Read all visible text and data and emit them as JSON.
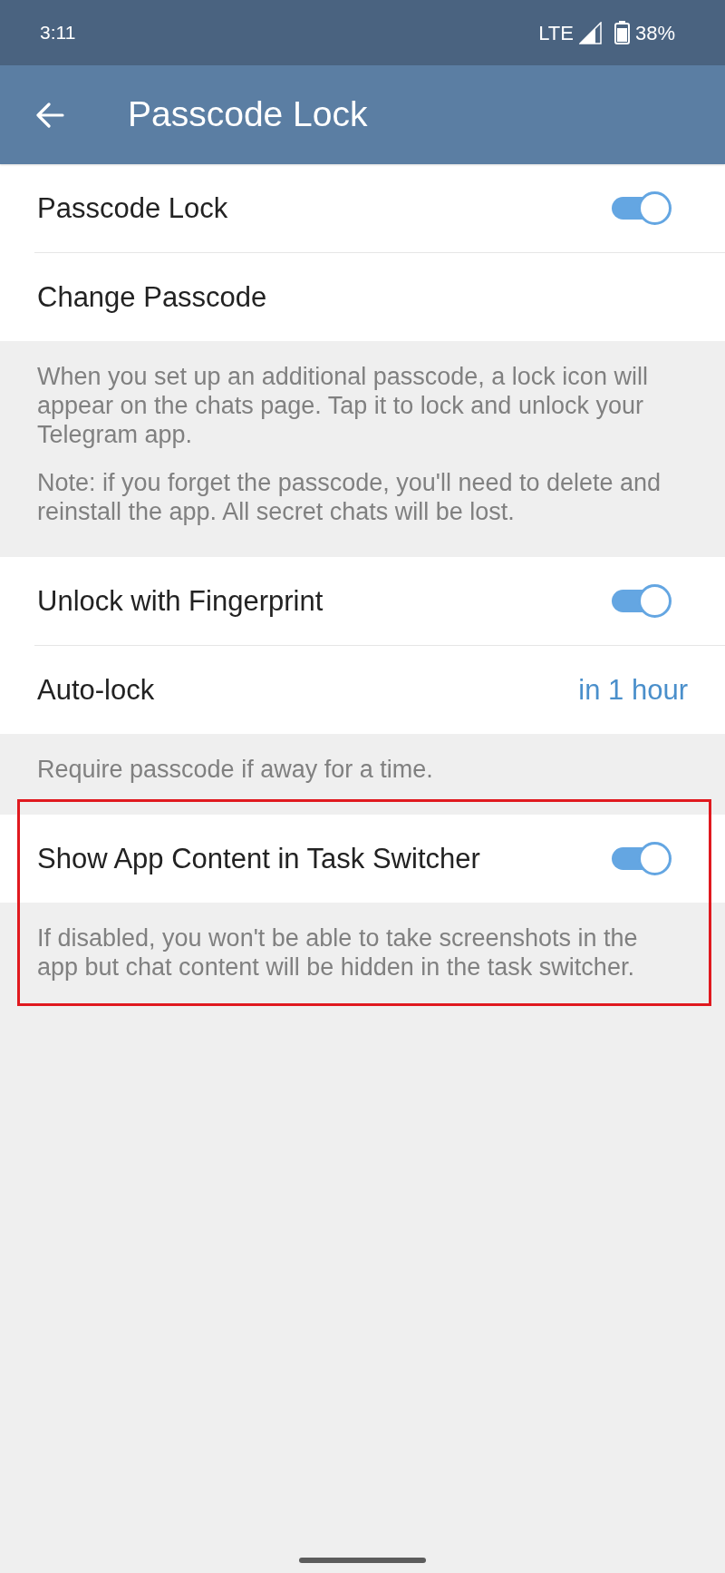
{
  "status_bar": {
    "time": "3:11",
    "network": "LTE",
    "battery": "38%"
  },
  "app_bar": {
    "title": "Passcode Lock"
  },
  "sections": [
    {
      "highlighted": false,
      "items": [
        {
          "kind": "toggle",
          "label": "Passcode Lock",
          "on": true
        },
        {
          "kind": "link",
          "label": "Change Passcode"
        }
      ],
      "notes": [
        "When you set up an additional passcode, a lock icon will appear on the chats page. Tap it to lock and unlock your Telegram app.",
        "Note: if you forget the passcode, you'll need to delete and reinstall the app. All secret chats will be lost."
      ]
    },
    {
      "highlighted": false,
      "items": [
        {
          "kind": "toggle",
          "label": "Unlock with Fingerprint",
          "on": true
        },
        {
          "kind": "value",
          "label": "Auto-lock",
          "value": "in 1 hour"
        }
      ],
      "notes": [
        "Require passcode if away for a time."
      ]
    },
    {
      "highlighted": true,
      "items": [
        {
          "kind": "toggle",
          "label": "Show App Content in Task Switcher",
          "on": true
        }
      ],
      "notes": [
        "If disabled, you won't be able to take screenshots in the app but chat content will be hidden in the task switcher."
      ]
    }
  ]
}
